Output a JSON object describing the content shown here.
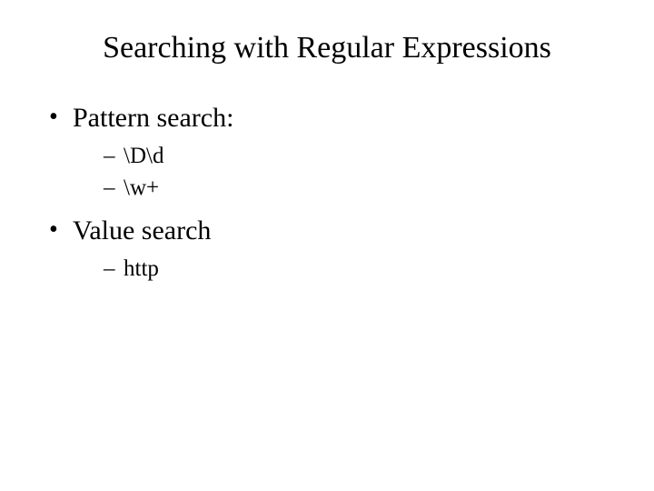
{
  "title": "Searching with Regular Expressions",
  "bullets": {
    "b0": {
      "label": "Pattern search:",
      "sub": {
        "s0": "\\D\\d",
        "s1": "\\w+"
      }
    },
    "b1": {
      "label": "Value search",
      "sub": {
        "s0": "http"
      }
    }
  }
}
